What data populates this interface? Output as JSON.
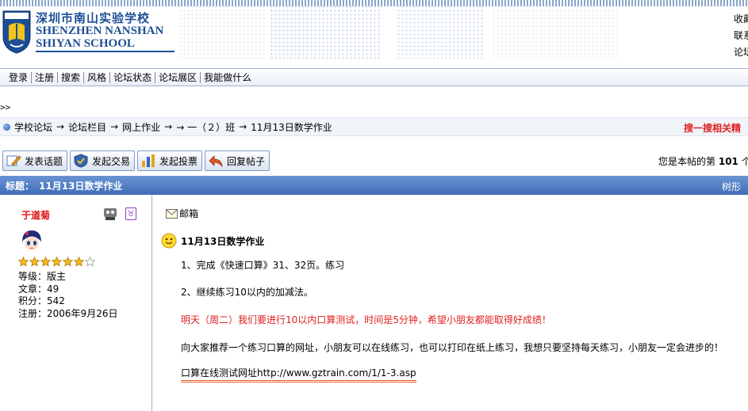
{
  "header": {
    "school_cn": "深圳市南山实验学校",
    "school_en_line1": "SHENZHEN NANSHAN",
    "school_en_line2": "SHIYAN SCHOOL",
    "links": [
      "收藏",
      "联系",
      "论坛"
    ]
  },
  "menu": {
    "items": [
      "登录",
      "注册",
      "搜索",
      "风格",
      "论坛状态",
      "论坛展区",
      "我能做什么"
    ]
  },
  "crumb_start": ">>",
  "breadcrumb": {
    "items": [
      "学校论坛",
      "论坛栏目",
      "网上作业",
      "→ 一（２）班",
      "11月13日数学作业"
    ],
    "arrow": "→",
    "search_text": "搜一搜相关精"
  },
  "actions": {
    "buttons": [
      {
        "label": "发表话题",
        "icon": "pencil-icon"
      },
      {
        "label": "发起交易",
        "icon": "shield-icon"
      },
      {
        "label": "发起投票",
        "icon": "bar-chart-icon"
      },
      {
        "label": "回复帖子",
        "icon": "reply-icon"
      }
    ],
    "post_count_prefix": "您是本帖的第",
    "post_count": "101",
    "post_count_suffix": "个"
  },
  "titlebar": {
    "label": "标题：",
    "title": "11月13日数学作业",
    "right_text": "树形"
  },
  "author": {
    "name": "于道菊",
    "rating_stars": 7,
    "filled_stars": 6,
    "level_label": "等级：",
    "level": "版主",
    "posts_label": "文章：",
    "posts": "49",
    "points_label": "积分：",
    "points": "542",
    "registered_label": "注册：",
    "registered": "2006年9月26日"
  },
  "post": {
    "mail_label": "邮箱",
    "title": "11月13日数学作业",
    "line1": "1、完成《快速口算》31、32页。练习",
    "line2": "2、继续练习10以内的加减法。",
    "line3": "明天（周二）我们要进行10以内口算测试，时间是5分钟，希望小朋友都能取得好成绩！",
    "line4": "向大家推荐一个练习口算的网址，小朋友可以在线练习，也可以打印在纸上练习，我想只要坚持每天练习，小朋友一定会进步的！",
    "link_text": "口算在线测试网址http://www.gztrain.com/1/1-3.asp"
  },
  "colors": {
    "brand_blue": "#1c4e96",
    "title_bar": "#4a78c2",
    "alert_red": "#e02020"
  }
}
